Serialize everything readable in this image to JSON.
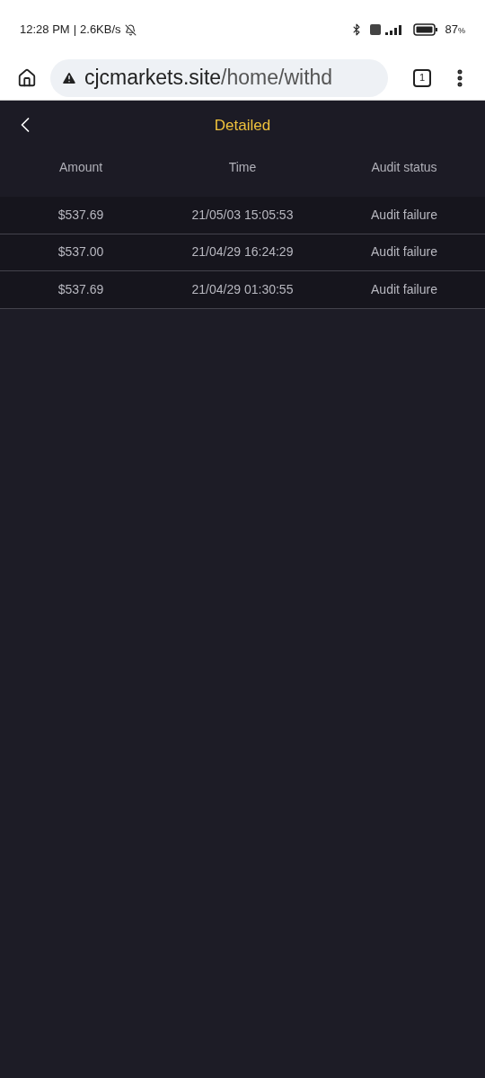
{
  "status_bar": {
    "time": "12:28 PM",
    "separator": "|",
    "speed": "2.6KB/s",
    "battery": "87",
    "battery_unit": "%"
  },
  "browser": {
    "url_host": "cjcmarkets.site",
    "url_path": "/home/withd",
    "tab_count": "1"
  },
  "page": {
    "title": "Detailed"
  },
  "table": {
    "columns": [
      "Amount",
      "Time",
      "Audit status"
    ],
    "rows": [
      [
        "$537.69",
        "21/05/03 15:05:53",
        "Audit failure"
      ],
      [
        "$537.00",
        "21/04/29 16:24:29",
        "Audit failure"
      ],
      [
        "$537.69",
        "21/04/29 01:30:55",
        "Audit failure"
      ]
    ]
  }
}
